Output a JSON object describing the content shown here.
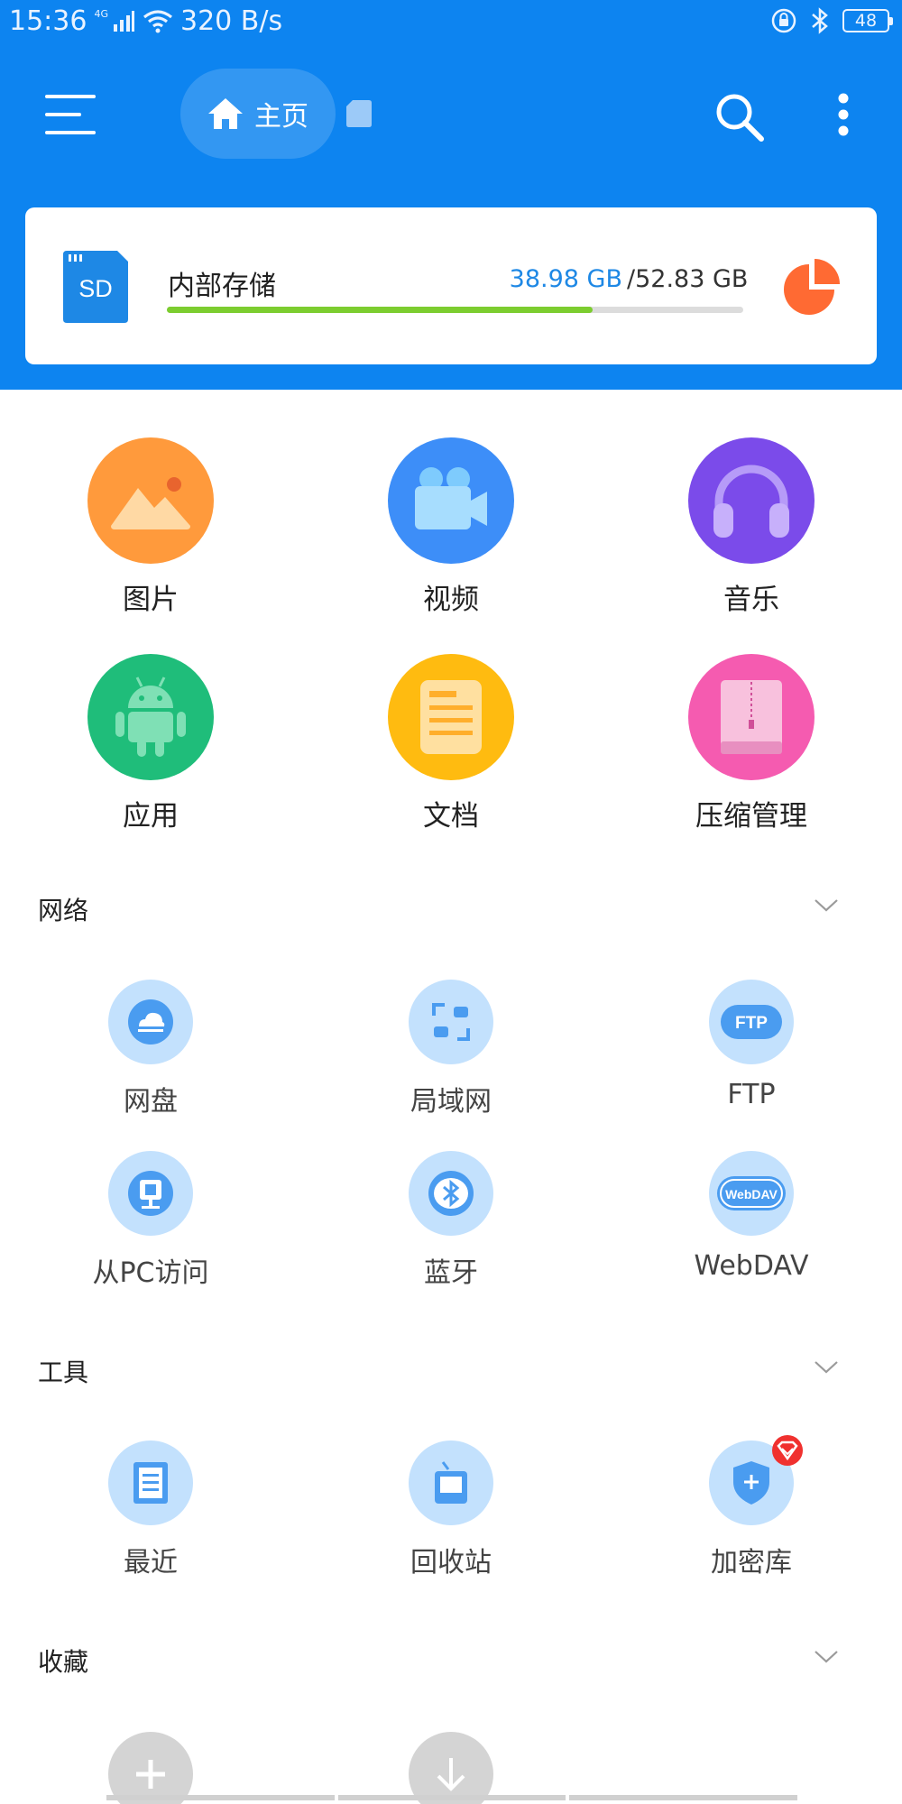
{
  "status_bar": {
    "time": "15:36",
    "network_type": "4G",
    "speed": "320 B/s",
    "battery": "48",
    "icons": [
      "signal-icon",
      "wifi-icon",
      "lock-icon",
      "bluetooth-icon",
      "battery-icon"
    ]
  },
  "header": {
    "home_tab_label": "主页",
    "icons": [
      "menu-icon",
      "home-icon",
      "sd-card-icon",
      "search-icon",
      "more-vert-icon"
    ],
    "background": "#0d84f0"
  },
  "storage": {
    "title": "内部存储",
    "used": "38.98 GB",
    "total": "/52.83 GB",
    "used_fraction": 0.738,
    "sd_label": "SD",
    "bar_color": "#7ccd2f"
  },
  "categories": [
    {
      "label": "图片",
      "icon": "image-icon",
      "color": "#ff9a3c"
    },
    {
      "label": "视频",
      "icon": "video-icon",
      "color": "#3d8ef8"
    },
    {
      "label": "音乐",
      "icon": "music-icon",
      "color": "#7b4bea"
    },
    {
      "label": "应用",
      "icon": "android-icon",
      "color": "#1fbd7a"
    },
    {
      "label": "文档",
      "icon": "document-icon",
      "color": "#ffbb10"
    },
    {
      "label": "压缩管理",
      "icon": "archive-icon",
      "color": "#f55bb0"
    }
  ],
  "sections": {
    "network": {
      "title": "网络",
      "items": [
        {
          "label": "网盘",
          "icon": "cloud-drive-icon"
        },
        {
          "label": "局域网",
          "icon": "lan-icon"
        },
        {
          "label": "FTP",
          "icon": "ftp-icon",
          "badge_text": "FTP"
        },
        {
          "label": "从PC访问",
          "icon": "pc-access-icon"
        },
        {
          "label": "蓝牙",
          "icon": "bluetooth-icon"
        },
        {
          "label": "WebDAV",
          "icon": "webdav-icon",
          "badge_text": "WebDAV"
        }
      ]
    },
    "tools": {
      "title": "工具",
      "items": [
        {
          "label": "最近",
          "icon": "recent-icon"
        },
        {
          "label": "回收站",
          "icon": "recycle-bin-icon"
        },
        {
          "label": "加密库",
          "icon": "vault-icon"
        }
      ]
    },
    "favorites": {
      "title": "收藏",
      "items": [
        {
          "icon": "add-icon"
        },
        {
          "icon": "download-icon"
        }
      ]
    }
  },
  "colors": {
    "accent": "#0d84f0",
    "tool_circle": "#c3e1fd",
    "tool_icon": "#4a9cf0",
    "pie": "#ff6a33",
    "vault_badge": "#f0312f"
  }
}
